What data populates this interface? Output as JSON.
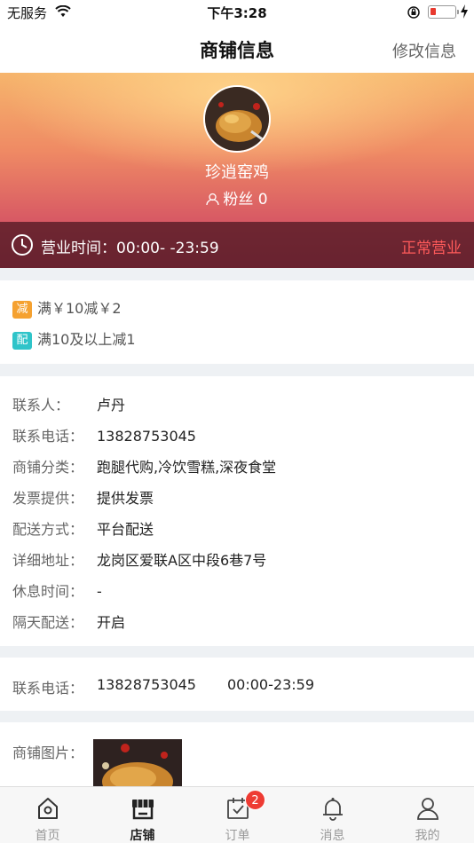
{
  "status_bar": {
    "carrier": "无服务",
    "time": "下午3:28",
    "battery_color": "#e8392e"
  },
  "nav": {
    "title": "商铺信息",
    "edit_label": "修改信息"
  },
  "shop": {
    "name": "珍逍窑鸡",
    "fans": "粉丝 0",
    "hours": "营业时间：00:00- -23:59",
    "status": "正常营业",
    "status_color": "#ff5a5a"
  },
  "promotions": [
    {
      "tag": "减",
      "tag_color": "#f5a130",
      "text": "满￥10减￥2"
    },
    {
      "tag": "配",
      "tag_color": "#2fc4c9",
      "text": "满10及以上减1"
    }
  ],
  "info": [
    {
      "label": "联系人：",
      "value": "卢丹"
    },
    {
      "label": "联系电话：",
      "value": "13828753045"
    },
    {
      "label": "商铺分类：",
      "value": "跑腿代购,冷饮雪糕,深夜食堂"
    },
    {
      "label": "发票提供：",
      "value": "提供发票"
    },
    {
      "label": "配送方式：",
      "value": "平台配送"
    },
    {
      "label": "详细地址：",
      "value": "龙岗区爱联A区中段6巷7号"
    },
    {
      "label": "休息时间：",
      "value": "-"
    },
    {
      "label": "隔天配送：",
      "value": "开启"
    }
  ],
  "contact": {
    "label": "联系电话：",
    "phone": "13828753045",
    "hours": "00:00-23:59"
  },
  "images": {
    "label": "商铺图片："
  },
  "tabs": [
    {
      "label": "首页",
      "icon": "home-icon",
      "active": false
    },
    {
      "label": "店铺",
      "icon": "shop-icon",
      "active": true
    },
    {
      "label": "订单",
      "icon": "order-icon",
      "active": false,
      "badge": "2"
    },
    {
      "label": "消息",
      "icon": "bell-icon",
      "active": false
    },
    {
      "label": "我的",
      "icon": "user-icon",
      "active": false
    }
  ]
}
